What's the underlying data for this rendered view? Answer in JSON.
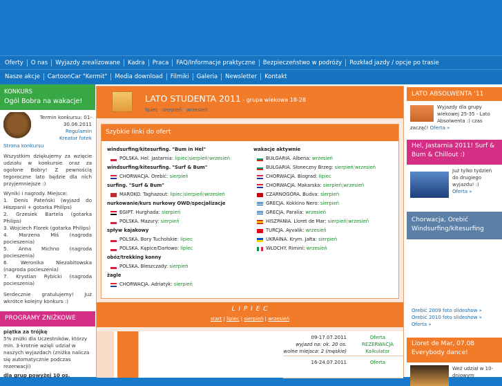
{
  "nav1": [
    "Oferty",
    "O nas",
    "Wyjazdy zrealizowane",
    "Kadra",
    "Praca",
    "FAQ/Informacje praktyczne",
    "Bezpieczeństwo w podróży",
    "Rozkład jazdy / opcje po trasie"
  ],
  "nav2": [
    "Nasze akcje",
    "CartoonCar \"Kermit\"",
    "Media download",
    "Filmiki",
    "Galeria",
    "Newsletter",
    "Kontakt"
  ],
  "konkurs": {
    "head": "KONKURS",
    "title": "Ogól Bobra na wakacje!",
    "termin": "Termin konkursu: 01-30.06.2011",
    "regulamin": "Regulamin",
    "kreator": "Kreator fotek",
    "strona": "Strona konkursu",
    "opis": "Wszystkim dziękujemy za wzięcie udziału w konkursie oraz za ogolone Bobry! Z pewnością tegoroczne lato będzie dla nich przyjemniejsze :)",
    "wyniki": "Wyniki i nagrody. Miejsce:",
    "winners": [
      "1. Denis Pateński (wyjazd do Hiszpanii + gotarka Philips)",
      "2. Grzesiek Bartela (gotarka Philips)",
      "3. Wojciech Florek (gotarka Philips)",
      "4. Marzena Miś (nagroda pocieszenia)",
      "5. Anna Michno (nagroda pocieszenia)",
      "6. Weronika Niezabitowska (nagroda pocieszenia)",
      "7. Krystian Rybicki (nagroda pocieszenia)"
    ],
    "gratulacje": "Serdecznie gratulujemy! Już wkrótce kolejny konkurs :)"
  },
  "programy": {
    "head": "PROGRAMY ZNIŻKOWE",
    "t1": "piątka za trójkę",
    "d1": "5% zniżki dla Uczestników, którzy min. 3-krotnie wzięli udział w naszych wyjazdach (zniżka nalicza się automatycznie podczas rezerwacji)",
    "t2": "dla grup powyżej 10 os."
  },
  "center": {
    "title": "LATO STUDENTA 2011",
    "sub": " - grupa wiekowa 18-28",
    "links": [
      "lipiec",
      "sierpień",
      "wrzesień"
    ],
    "quick_title": "Szybkie linki do ofert",
    "left": [
      {
        "cat": "windsurfing/kitesurfing. \"Bum in Hel\""
      },
      {
        "flag": "pl",
        "place": "POLSKA. Hel. Jastarnia:",
        "m": [
          "lipiec",
          "sierpień",
          "wrzesień"
        ]
      },
      {
        "cat": "windsurfing/kitesurfing. \"Surf & Bum\""
      },
      {
        "flag": "hr",
        "place": "CHORWACJA. Orebić:",
        "m": [
          "sierpień"
        ]
      },
      {
        "cat": "surfing. \"Surf & Bum\""
      },
      {
        "flag": "ma",
        "place": "MAROKO. Taghazout:",
        "m": [
          "lipiec",
          "sierpień",
          "wrzesień"
        ]
      },
      {
        "cat": "nurkowanie/kurs nurkowy OWD/specjalizacje"
      },
      {
        "flag": "eg",
        "place": "EGIPT. Hurghada:",
        "m": [
          "sierpień"
        ]
      },
      {
        "flag": "pl",
        "place": "POLSKA. Mazury:",
        "m": [
          "sierpień"
        ]
      },
      {
        "cat": "spływ kajakowy"
      },
      {
        "flag": "pl",
        "place": "POLSKA. Bory Tucholskie:",
        "m": [
          "lipiec"
        ]
      },
      {
        "flag": "pl",
        "place": "POLSKA. Kępice/Darłowo:",
        "m": [
          "lipiec"
        ]
      },
      {
        "cat": "obóz/trekking konny"
      },
      {
        "flag": "pl",
        "place": "POLSKA. Bieszczady:",
        "m": [
          "sierpień"
        ]
      },
      {
        "cat": "żagle"
      },
      {
        "flag": "hr",
        "place": "CHORWACJA. Adriatyk:",
        "m": [
          "sierpień"
        ]
      }
    ],
    "right": [
      {
        "cat": "wakacje aktywnie"
      },
      {
        "flag": "bg",
        "place": "BUŁGARIA. Albena:",
        "m": [
          "wrzesień"
        ]
      },
      {
        "flag": "bg",
        "place": "BUŁGARIA. Słoneczny Brzeg:",
        "m": [
          "sierpień",
          "wrzesień"
        ]
      },
      {
        "flag": "hr",
        "place": "CHORWACJA. Biograd:",
        "m": [
          "lipiec"
        ]
      },
      {
        "flag": "hr",
        "place": "CHORWACJA. Makarska:",
        "m": [
          "sierpień",
          "wrzesień"
        ]
      },
      {
        "flag": "me",
        "place": "CZARNOGÓRA. Budva:",
        "m": [
          "sierpień"
        ]
      },
      {
        "flag": "gr",
        "place": "GRECJA. Kokkino Nero:",
        "m": [
          "sierpień"
        ]
      },
      {
        "flag": "gr",
        "place": "GRECJA. Paralia:",
        "m": [
          "wrzesień"
        ]
      },
      {
        "flag": "es",
        "place": "HISZPANIA. Lloret de Mar:",
        "m": [
          "sierpień",
          "wrzesień"
        ]
      },
      {
        "flag": "tr",
        "place": "TURCJA. Ayvalik:",
        "m": [
          "wrzesień"
        ]
      },
      {
        "flag": "ua",
        "place": "UKRAINA. Krym. Jałta:",
        "m": [
          "sierpień"
        ]
      },
      {
        "flag": "it",
        "place": "WŁOCHY. Rimini:",
        "m": [
          "wrzesień"
        ]
      }
    ],
    "lipiec": "L I P I E C",
    "months": [
      "start",
      "lipiec",
      "sierpień",
      "wrzesień"
    ],
    "trips": [
      {
        "date": "09-17.07.2011",
        "l2": "wyjazd na: ok. 20 os.",
        "l3": "wolne miejsca: 2 (męskie)",
        "o1": "Oferta",
        "o2": "REZERWACJA",
        "o3": "Kalkulator"
      },
      {
        "date": "16-24.07.2011",
        "l2": "",
        "l3": "",
        "o1": "Oferta",
        "o2": "",
        "o3": ""
      }
    ]
  },
  "right": {
    "absol_head": "LATO ABSOLWENTA '11",
    "absol_txt": "Wyjazdy dla grupy wiekowej 25-35 - Lato Absolwenta :) czas zacząć!",
    "absol_link": "Oferta »",
    "hel_head": "Hel, Jastarnia 2011! Surf & Bum & Chillout :)",
    "hel_txt": "Już tylko tydzień do drugiego wyjazdu! :)",
    "hel_link": "Oferta »",
    "chor_head": "Chorwacja, Orebić Windsurfing/kitesurfing",
    "chor_links": [
      "Orebić 2009 foto slideshow »",
      "Orebić 2010 foto slideshow »",
      "Oferta »"
    ],
    "lloret_head": "Lloret de Mar, 07.08 Everybody dance!",
    "lloret_txt": "Weź udział w 10-dniowym"
  },
  "colors": {
    "blue": "#1679c9",
    "green": "#37a844",
    "orange": "#f27b2a",
    "pink": "#d52e85",
    "slate": "#5b7fa6"
  }
}
